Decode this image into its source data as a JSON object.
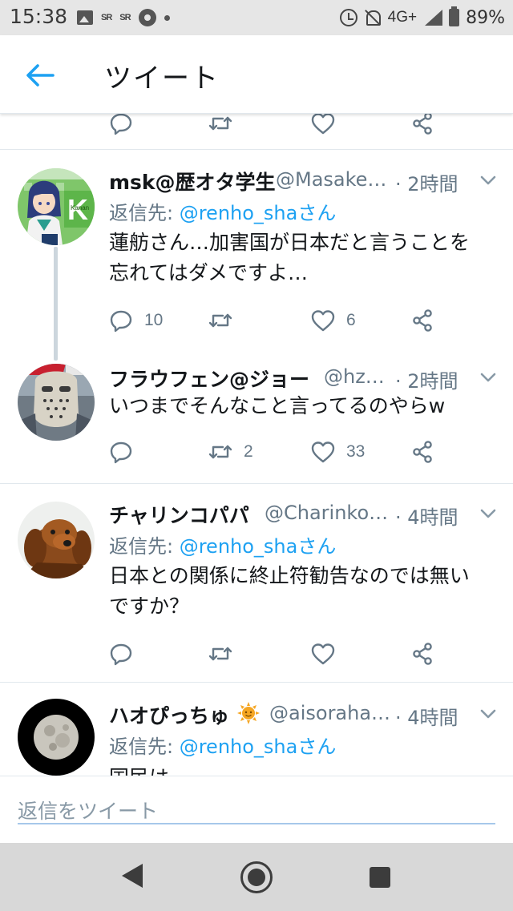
{
  "status_bar": {
    "time": "15:38",
    "left_icons": [
      "image-icon",
      "sr-app-icon",
      "sr-app-icon",
      "chrome-icon",
      "dot-icon"
    ],
    "sr_label": "SR",
    "network": "4G+",
    "battery": "89%"
  },
  "header": {
    "back_icon": "arrow-left-icon",
    "title": "ツイート"
  },
  "colors": {
    "accent": "#1da1f2",
    "secondary_text": "#657786",
    "divider": "#e1e8ed",
    "thread_line": "#ccd6dd"
  },
  "top_actions": {
    "reply_count": "",
    "retweet_count": "",
    "like_count": ""
  },
  "tweets": [
    {
      "name": "msk@歴オタ学生",
      "handle": "@Masake…",
      "time": "· 2時間",
      "reply_prefix": "返信先: ",
      "reply_mention": "@renho_shaさん",
      "body": [
        "蓮舫さん…加害国が日本だと言うことを",
        "忘れてはダメですよ…"
      ],
      "reply_count": "10",
      "retweet_count": "",
      "like_count": "6",
      "avatar_badge": "Kanan"
    },
    {
      "name": "フラウフェン@ジョー",
      "handle": "@hz…",
      "time": "· 2時間",
      "body": [
        "いつまでそんなこと言ってるのやらw"
      ],
      "reply_count": "",
      "retweet_count": "2",
      "like_count": "33"
    },
    {
      "name": "チャリンコパパ",
      "handle": "@Charinko…",
      "time": "· 4時間",
      "reply_prefix": "返信先: ",
      "reply_mention": "@renho_shaさん",
      "body": [
        "日本との関係に終止符勧告なのでは無い",
        "ですか？"
      ],
      "reply_count": "",
      "retweet_count": "",
      "like_count": ""
    },
    {
      "name": "ハオぴっちゅ",
      "name_emoji": "sun-emoji-icon",
      "handle": "@aisoraha…",
      "time": "· 4時間",
      "reply_prefix": "返信先: ",
      "reply_mention": "@renho_shaさん",
      "body": [
        "国民は"
      ]
    }
  ],
  "compose": {
    "placeholder": "返信をツイート"
  },
  "nav_bar": {
    "icons": [
      "nav-back-icon",
      "nav-home-icon",
      "nav-recents-icon"
    ]
  }
}
